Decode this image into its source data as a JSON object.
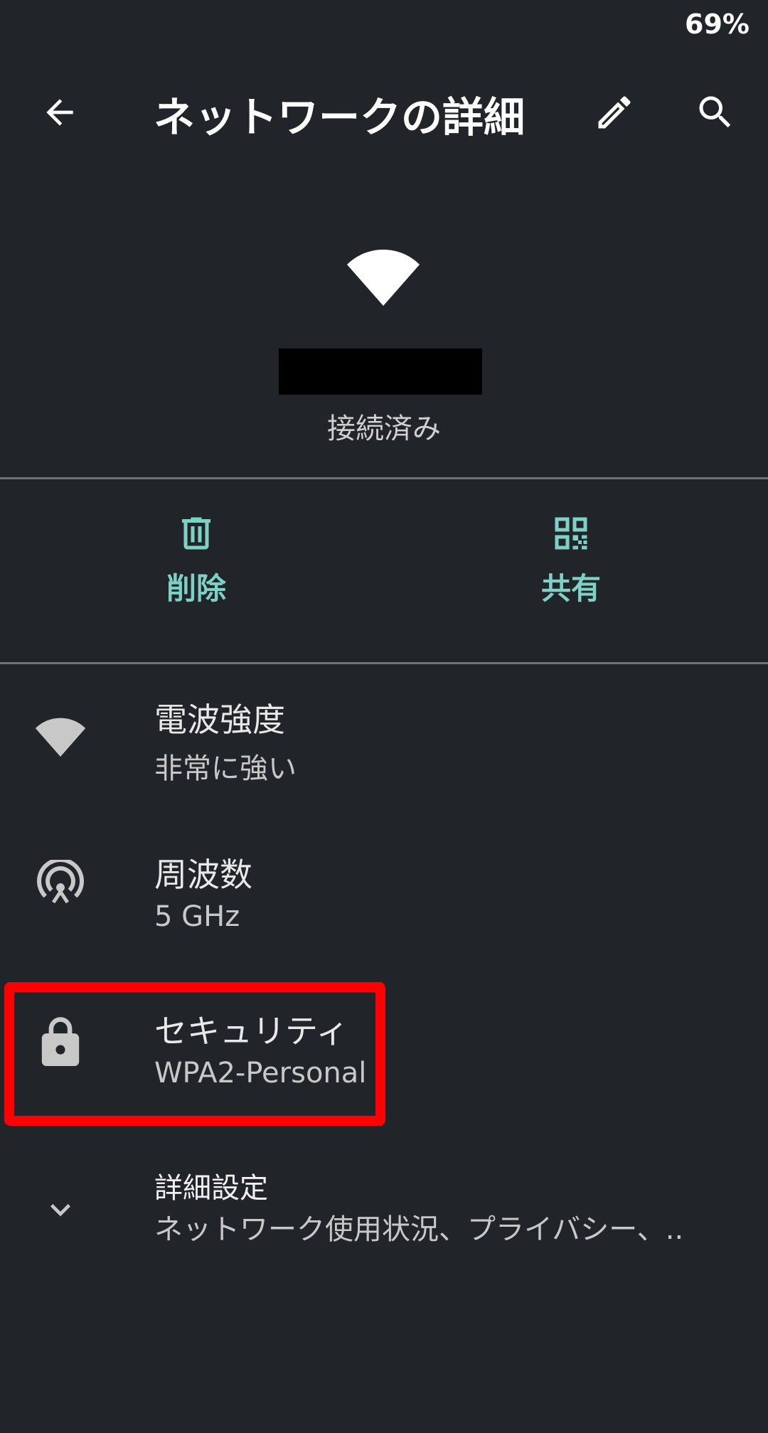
{
  "status_bar": {
    "battery": "69%"
  },
  "app_bar": {
    "back_icon": "arrow-back-icon",
    "title": "ネットワークの詳細",
    "edit_icon": "pencil-icon",
    "search_icon": "search-icon"
  },
  "header": {
    "wifi_icon": "wifi-icon",
    "connection_status": "接続済み"
  },
  "actions": [
    {
      "icon": "trash-icon",
      "label": "削除"
    },
    {
      "icon": "qr-code-icon",
      "label": "共有"
    }
  ],
  "details": [
    {
      "icon": "wifi-icon",
      "title": "電波強度",
      "value": "非常に強い"
    },
    {
      "icon": "frequency-antenna-icon",
      "title": "周波数",
      "value": "5 GHz"
    },
    {
      "icon": "lock-icon",
      "title": "セキュリティ",
      "value": "WPA2-Personal"
    },
    {
      "icon": "chevron-down-icon",
      "title": "詳細設定",
      "value": "ネットワーク使用状況、プライバシー、.."
    }
  ],
  "colors": {
    "background": "#212529",
    "accent": "#7fd1c6",
    "highlight": "#ff0000"
  }
}
